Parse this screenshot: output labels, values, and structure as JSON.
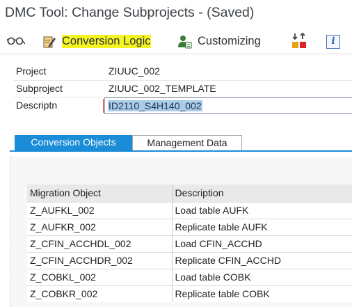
{
  "window": {
    "title": "DMC Tool: Change Subprojects - (Saved)"
  },
  "toolbar": {
    "conversion_logic": "Conversion Logic",
    "customizing": "Customizing",
    "info_glyph": "i",
    "icons": [
      "glasses-icon",
      "pencil-icon",
      "person-icon",
      "sort-icon",
      "info-icon"
    ],
    "highlight_color": "#f5f523"
  },
  "form": {
    "project_label": "Project",
    "project_value": "ZIUUC_002",
    "subproject_label": "Subproject",
    "subproject_value": "ZIUUC_002_TEMPLATE",
    "description_label": "Descriptn",
    "description_value": "ID2110_S4H140_002"
  },
  "tabs": [
    {
      "label": "Conversion Objects",
      "active": true
    },
    {
      "label": "Management Data",
      "active": false
    }
  ],
  "accent_color": "#1a8cd8",
  "table": {
    "headers": [
      "Migration Object",
      "Description"
    ],
    "rows": [
      [
        "Z_AUFKL_002",
        "Load table AUFK"
      ],
      [
        "Z_AUFKR_002",
        "Replicate table AUFK"
      ],
      [
        "Z_CFIN_ACCHDL_002",
        "Load CFIN_ACCHD"
      ],
      [
        "Z_CFIN_ACCHDR_002",
        "Replicate CFIN_ACCHD"
      ],
      [
        "Z_COBKL_002",
        "Load table COBK"
      ],
      [
        "Z_COBKR_002",
        "Replicate table COBK"
      ]
    ]
  }
}
